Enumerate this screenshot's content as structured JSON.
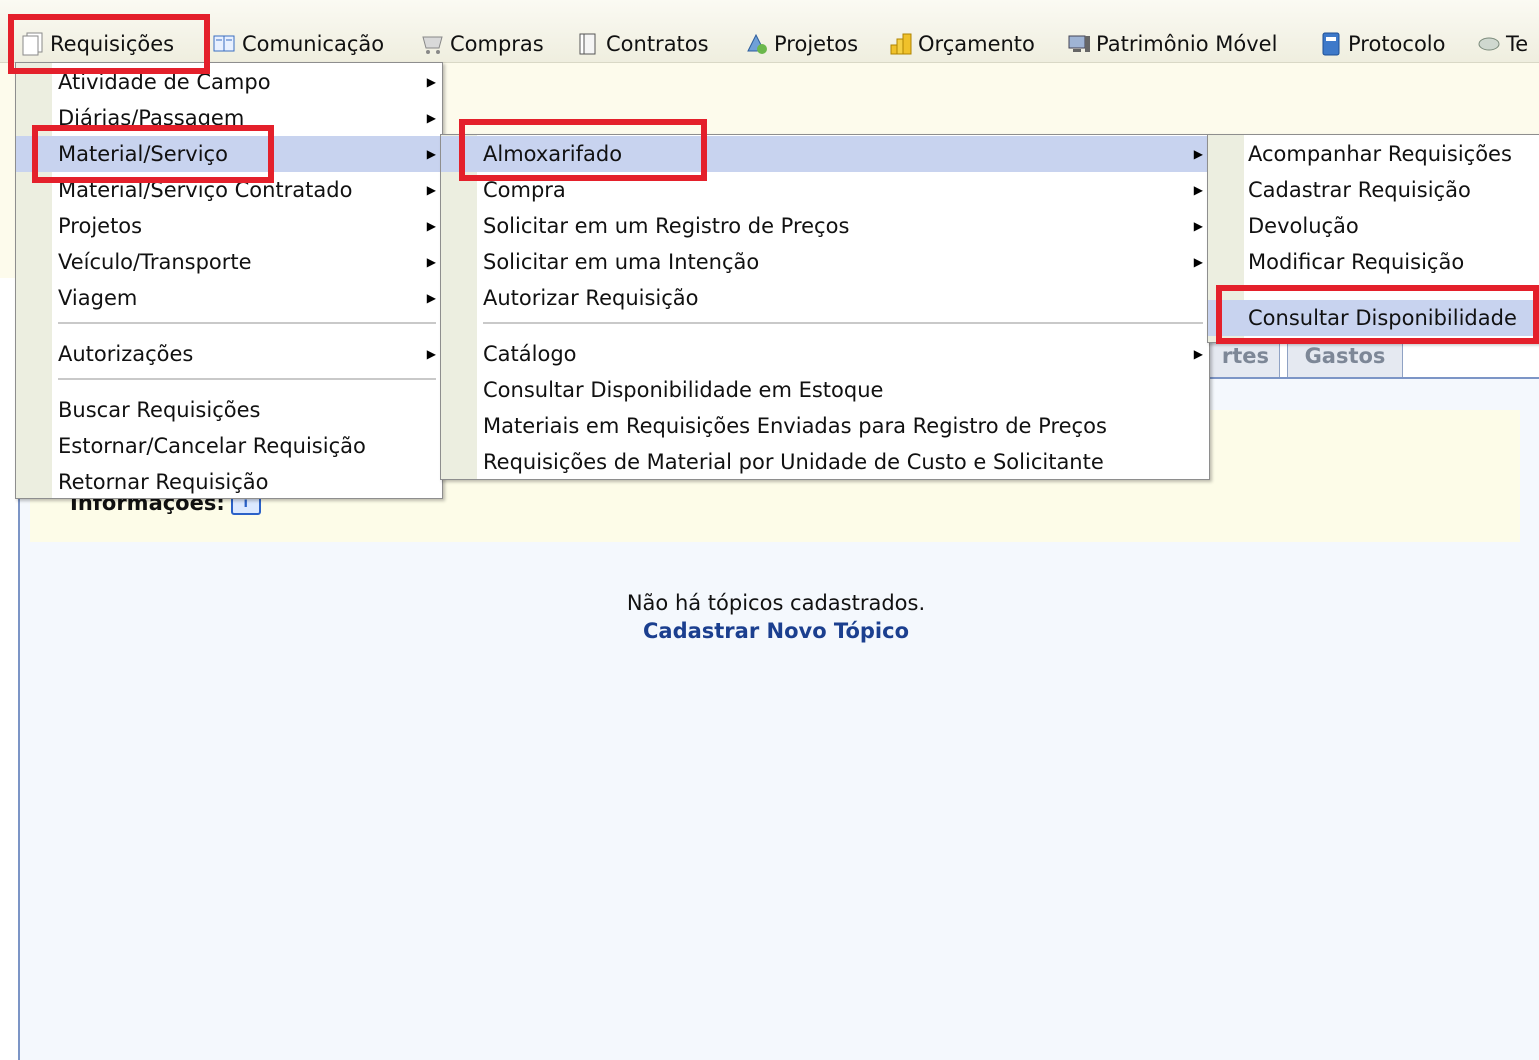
{
  "menubar": {
    "items": [
      {
        "label": "Requisições",
        "icon": "document-icon"
      },
      {
        "label": "Comunicação",
        "icon": "book-icon"
      },
      {
        "label": "Compras",
        "icon": "cart-icon"
      },
      {
        "label": "Contratos",
        "icon": "contract-icon"
      },
      {
        "label": "Projetos",
        "icon": "project-icon"
      },
      {
        "label": "Orçamento",
        "icon": "coins-icon"
      },
      {
        "label": "Patrimônio Móvel",
        "icon": "computer-icon"
      },
      {
        "label": "Protocolo",
        "icon": "binder-icon"
      },
      {
        "label": "Te",
        "icon": "tag-icon"
      }
    ]
  },
  "menu_level1": {
    "items": [
      {
        "label": "Atividade de Campo",
        "submenu": true
      },
      {
        "label": "Diárias/Passagem",
        "submenu": true
      },
      {
        "label": "Material/Serviço",
        "submenu": true,
        "active": true
      },
      {
        "label": "Material/Serviço Contratado",
        "submenu": true
      },
      {
        "label": "Projetos",
        "submenu": true
      },
      {
        "label": "Veículo/Transporte",
        "submenu": true
      },
      {
        "label": "Viagem",
        "submenu": true
      },
      {
        "label": "Autorizações",
        "submenu": true
      },
      {
        "label": "Buscar Requisições",
        "submenu": false
      },
      {
        "label": "Estornar/Cancelar Requisição",
        "submenu": false
      },
      {
        "label": "Retornar Requisição",
        "submenu": false
      }
    ]
  },
  "menu_level2": {
    "items": [
      {
        "label": "Almoxarifado",
        "submenu": true,
        "active": true
      },
      {
        "label": "Compra",
        "submenu": true
      },
      {
        "label": "Solicitar em um Registro de Preços",
        "submenu": true
      },
      {
        "label": "Solicitar em uma Intenção",
        "submenu": true
      },
      {
        "label": "Autorizar Requisição",
        "submenu": false
      },
      {
        "label": "Catálogo",
        "submenu": true
      },
      {
        "label": "Consultar Disponibilidade em Estoque",
        "submenu": false
      },
      {
        "label": "Materiais em Requisições Enviadas para Registro de Preços",
        "submenu": false
      },
      {
        "label": "Requisições de Material por Unidade de Custo e Solicitante",
        "submenu": false
      }
    ]
  },
  "menu_level3": {
    "items": [
      {
        "label": "Acompanhar Requisições"
      },
      {
        "label": "Cadastrar Requisição"
      },
      {
        "label": "Devolução"
      },
      {
        "label": "Modificar Requisição"
      },
      {
        "label": "Consultar Disponibilidade",
        "active": true
      }
    ]
  },
  "tabs": {
    "partial_label": "rtes",
    "gastos_label": "Gastos"
  },
  "content": {
    "info_label": "Informações:",
    "empty_message": "Não há tópicos cadastrados.",
    "new_topic_link": "Cadastrar Novo Tópico"
  },
  "colors": {
    "highlight": "#e4202b",
    "menu_active": "#c8d3ef",
    "link": "#1b3f8f"
  }
}
